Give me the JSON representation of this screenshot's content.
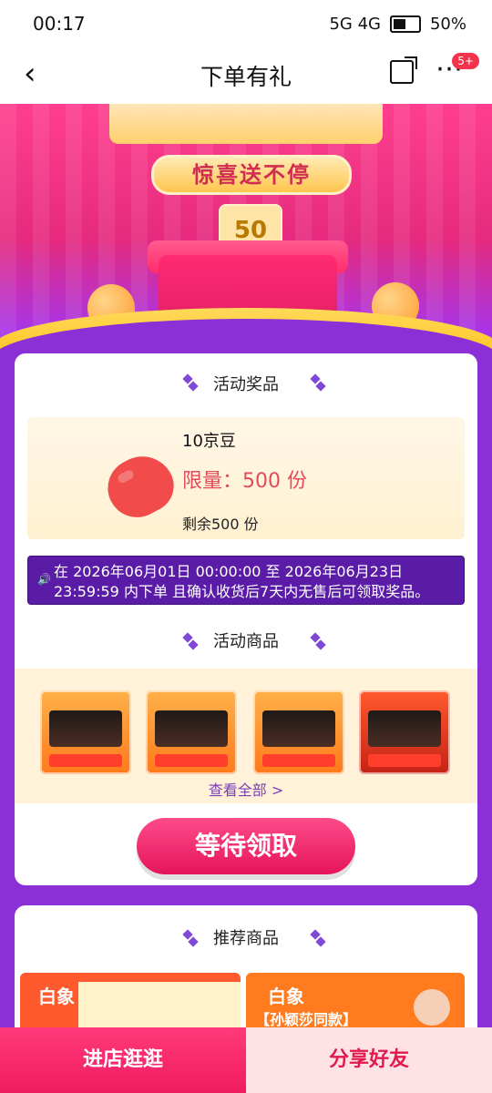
{
  "status": {
    "time": "00:17",
    "network": "5G 4G",
    "battery": "50%"
  },
  "nav": {
    "title": "下单有礼",
    "badge": "5+"
  },
  "banner": {
    "slogan": "惊喜送不停",
    "ticket_value": "50"
  },
  "reward_section": {
    "title": "活动奖品",
    "prize_name": "10京豆",
    "limit_text": "限量：500 份",
    "remaining": "剩余500 份"
  },
  "notice": {
    "text": "在 2026年06月01日 00:00:00 至 2026年06月23日 23:59:59 内下单 且确认收货后7天内无售后可领取奖品。"
  },
  "goods_section": {
    "title": "活动商品",
    "view_all": "查看全部 >"
  },
  "action": {
    "wait_label": "等待领取"
  },
  "recommend_section": {
    "title": "推荐商品",
    "brand_label": "白象",
    "promo_text": "【孙颖莎同款】"
  },
  "bottom": {
    "shop_label": "进店逛逛",
    "share_label": "分享好友"
  },
  "colors": {
    "accent_pink": "#f01b60",
    "purple": "#8b2fd6",
    "prize_red": "#f24b4b"
  }
}
